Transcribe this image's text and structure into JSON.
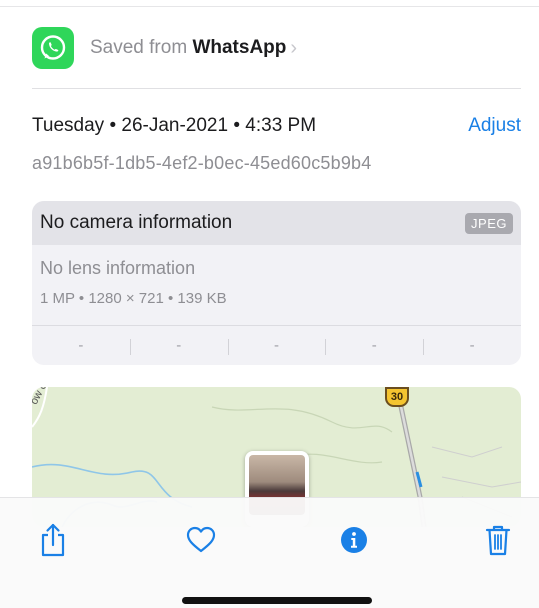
{
  "source": {
    "prefix": "Saved from",
    "app_name": "WhatsApp",
    "app_icon": "whatsapp-icon",
    "chevron_icon": "chevron-right-icon",
    "brand_color": "#2fd65a"
  },
  "metadata": {
    "datetime": "Tuesday • 26-Jan-2021 • 4:33 PM",
    "adjust_label": "Adjust",
    "filename": "a91b6b5f-1db5-4ef2-b0ec-45ed60c5b9b4"
  },
  "camera_card": {
    "camera_label": "No camera information",
    "format_badge": "JPEG",
    "lens_label": "No lens information",
    "specs": "1 MP • 1280 × 721 • 139 KB",
    "exif_values": [
      "-",
      "-",
      "-",
      "-",
      "-"
    ]
  },
  "map": {
    "road_label": "ow o",
    "route_number": "30"
  },
  "toolbar": {
    "items": [
      "share-icon",
      "heart-icon",
      "info-icon",
      "trash-icon"
    ],
    "accent_color": "#1a80e6"
  }
}
